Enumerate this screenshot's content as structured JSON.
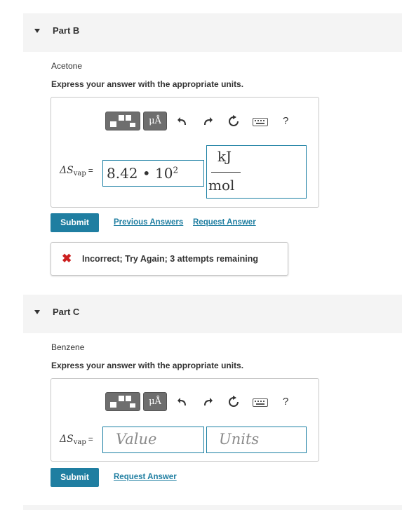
{
  "part_b": {
    "header": "Part B",
    "subject": "Acetone",
    "instruction": "Express your answer with the appropriate units.",
    "toolbar": {
      "mu_label": "μÅ",
      "help": "?"
    },
    "variable": {
      "symbol": "ΔS",
      "subscript": "vap",
      "equals": "="
    },
    "value_input": {
      "mantissa": "8.42",
      "dot": "•",
      "base": "10",
      "exponent": "2"
    },
    "units": {
      "numerator": "kJ",
      "denominator": "mol"
    },
    "submit_label": "Submit",
    "previous_answers_label": "Previous Answers",
    "request_answer_label": "Request Answer",
    "feedback": {
      "icon": "✖",
      "message": "Incorrect; Try Again; 3 attempts remaining"
    }
  },
  "part_c": {
    "header": "Part C",
    "subject": "Benzene",
    "instruction": "Express your answer with the appropriate units.",
    "toolbar": {
      "mu_label": "μÅ",
      "help": "?"
    },
    "variable": {
      "symbol": "ΔS",
      "subscript": "vap",
      "equals": "="
    },
    "value_placeholder": "Value",
    "units_placeholder": "Units",
    "submit_label": "Submit",
    "request_answer_label": "Request Answer"
  },
  "colors": {
    "accent": "#1f7ea1",
    "error": "#cc1f1f",
    "header_bg": "#f4f4f4"
  }
}
